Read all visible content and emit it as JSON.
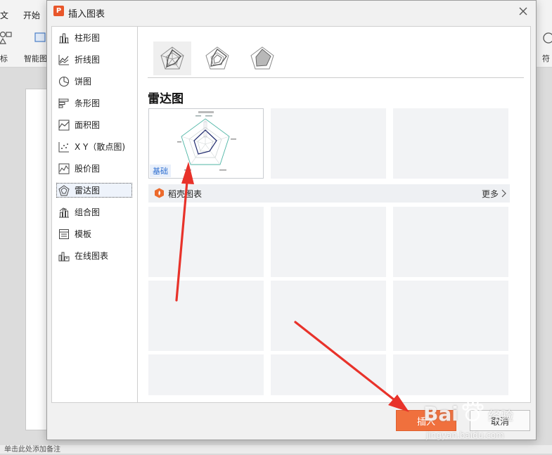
{
  "app": {
    "tabs": [
      "文",
      "开始"
    ],
    "ribbon_buttons": [
      "标",
      "智能图",
      "符"
    ],
    "status_text": "单击此处添加备注"
  },
  "dialog": {
    "title": "插入图表",
    "app_icon_letter": "P",
    "close_icon": "close-icon"
  },
  "sidebar": {
    "items": [
      {
        "label": "柱形图",
        "icon": "column-chart-icon"
      },
      {
        "label": "折线图",
        "icon": "line-chart-icon"
      },
      {
        "label": "饼图",
        "icon": "pie-chart-icon"
      },
      {
        "label": "条形图",
        "icon": "bar-chart-icon"
      },
      {
        "label": "面积图",
        "icon": "area-chart-icon"
      },
      {
        "label": "X Y（散点图)",
        "icon": "scatter-chart-icon"
      },
      {
        "label": "股价图",
        "icon": "stock-chart-icon"
      },
      {
        "label": "雷达图",
        "icon": "radar-chart-icon",
        "selected": true
      },
      {
        "label": "组合图",
        "icon": "combo-chart-icon"
      },
      {
        "label": "模板",
        "icon": "template-icon"
      },
      {
        "label": "在线图表",
        "icon": "online-chart-icon"
      }
    ]
  },
  "content": {
    "variants": [
      "radar",
      "radar-markers",
      "filled-radar"
    ],
    "section_title": "雷达图",
    "basic_badge": "基础",
    "online_section": {
      "label": "稻壳图表",
      "more_label": "更多"
    }
  },
  "buttons": {
    "insert": "插入",
    "cancel": "取消"
  },
  "watermark": {
    "brand": "Bai",
    "brand2": "经验",
    "url": "jingyan.baidu.com"
  },
  "colors": {
    "accent": "#f0703d",
    "link_blue": "#2f6fd0",
    "arrow_red": "#e8322a"
  }
}
